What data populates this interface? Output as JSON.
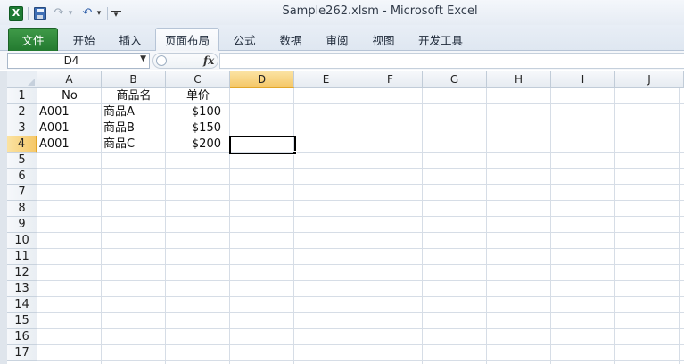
{
  "window": {
    "title": "Sample262.xlsm  -  Microsoft Excel",
    "app_icon": "X",
    "quick_access": {
      "save_icon": "save-icon",
      "redo_glyph": "↷",
      "undo_glyph": "↶",
      "dropdown_glyph": "▾",
      "customize_glyph": "▾"
    }
  },
  "ribbon": {
    "tabs": [
      "文件",
      "开始",
      "插入",
      "页面布局",
      "公式",
      "数据",
      "审阅",
      "视图",
      "开发工具"
    ],
    "active_tab": "页面布局"
  },
  "formula_bar": {
    "name_box": "D4",
    "fx_label": "fx",
    "formula": ""
  },
  "sheet": {
    "columns": [
      "A",
      "B",
      "C",
      "D",
      "E",
      "F",
      "G",
      "H",
      "I",
      "J"
    ],
    "selected_column": "D",
    "rows": [
      "1",
      "2",
      "3",
      "4",
      "5",
      "6",
      "7",
      "8",
      "9",
      "10",
      "11",
      "12",
      "13",
      "14",
      "15",
      "16",
      "17"
    ],
    "selected_row": "4",
    "cells": {
      "A1": "No",
      "B1": "商品名",
      "C1": "单价",
      "A2": "A001",
      "B2": "商品A",
      "C2": "$100",
      "A3": "A001",
      "B3": "商品B",
      "C3": "$150",
      "A4": "A001",
      "B4": "商品C",
      "C4": "$200"
    },
    "active_cell": "D4"
  },
  "colors": {
    "file_tab": "#2a8a38",
    "selection_header": "#f5c869",
    "gridline": "#d6dde6"
  }
}
